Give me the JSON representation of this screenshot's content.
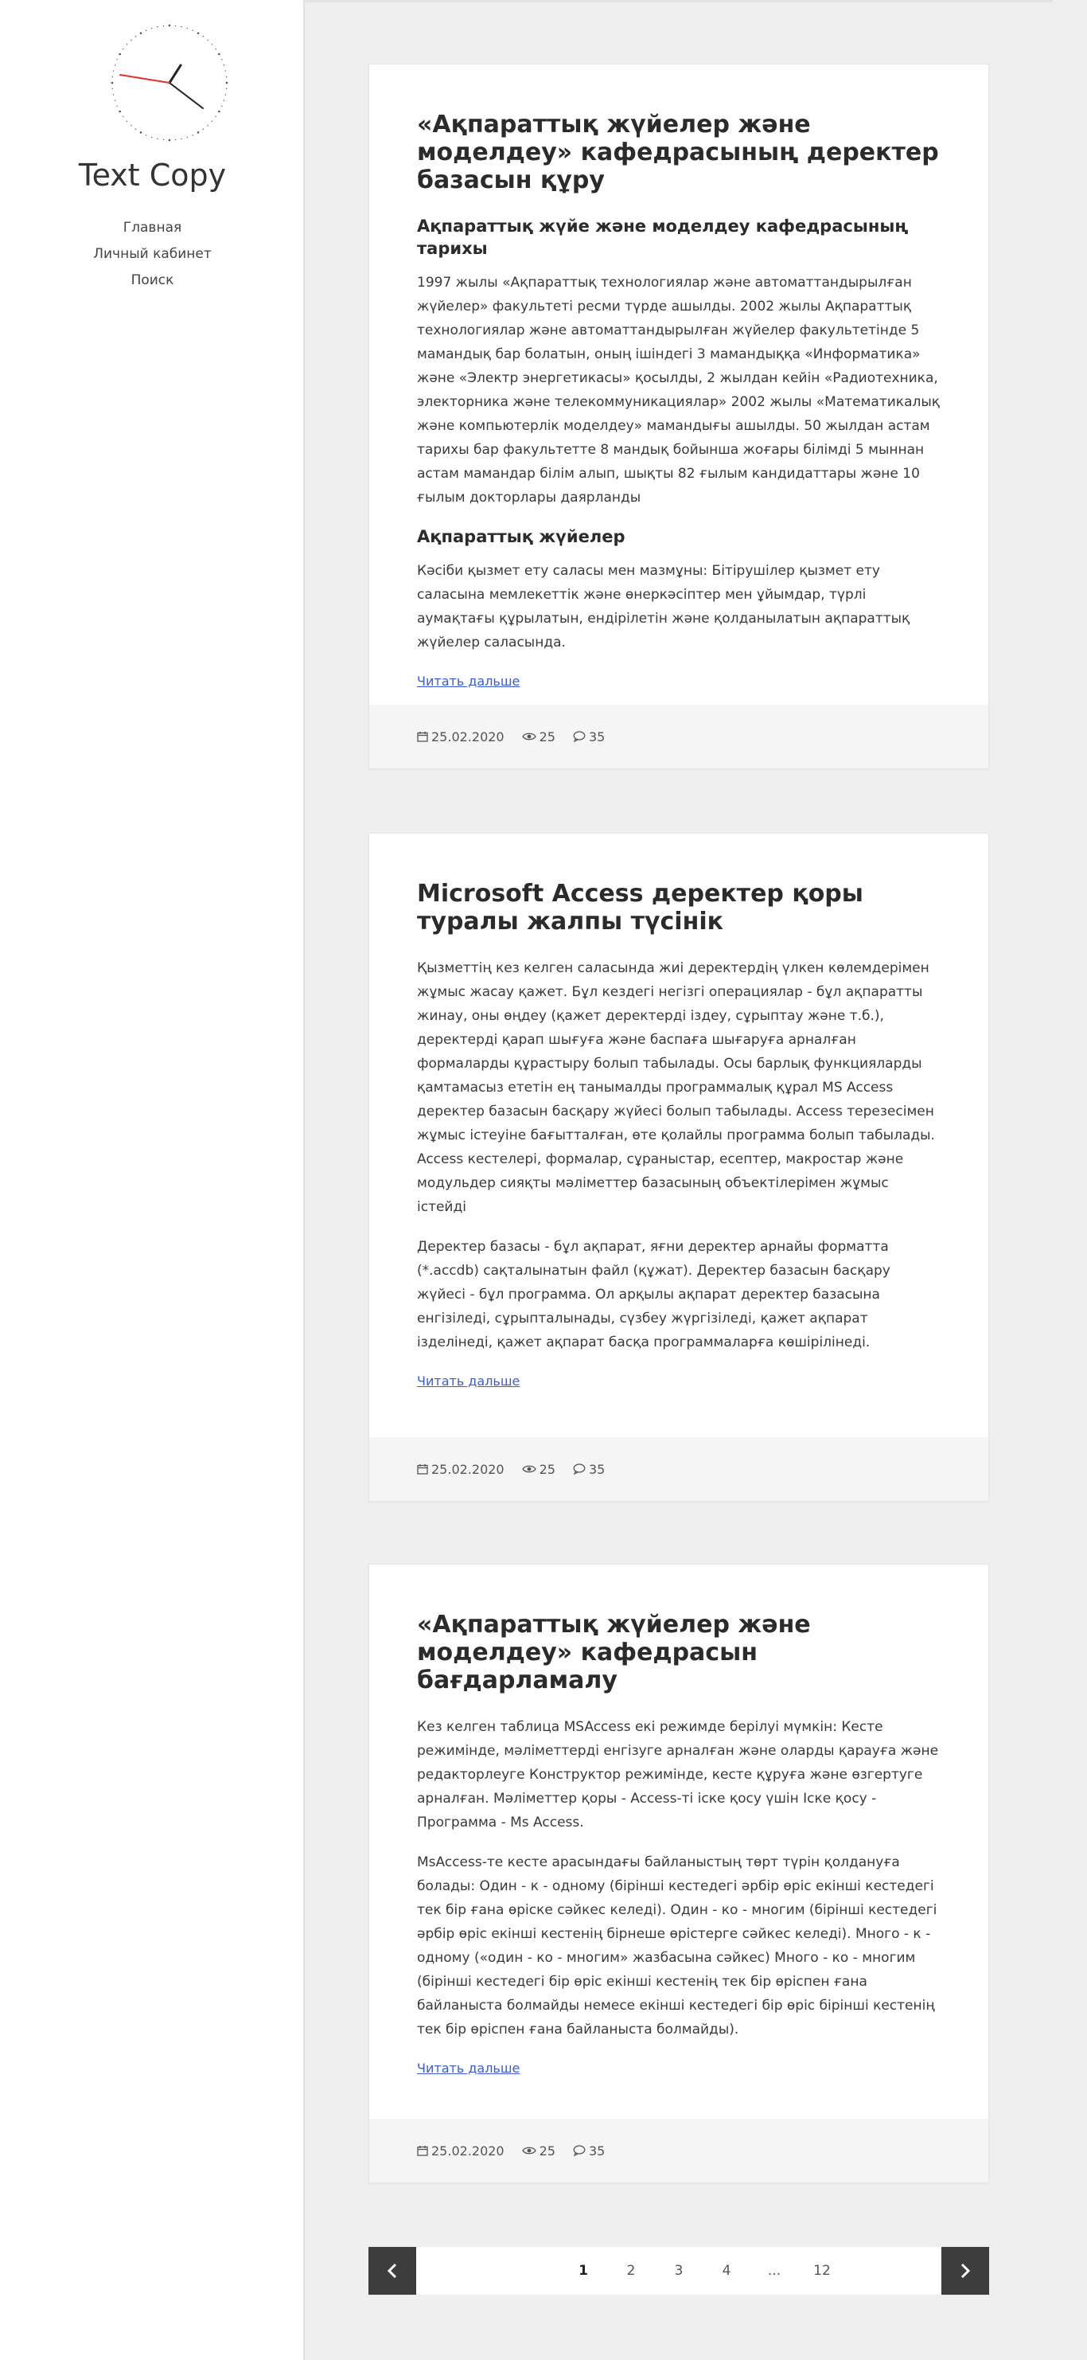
{
  "sidebar": {
    "site_title": "Text Copy",
    "nav": [
      "Главная",
      "Личный кабинет",
      "Поиск"
    ]
  },
  "posts": [
    {
      "title": "«Ақпараттық жүйелер және моделдеу» кафедрасының деректер базасын құру",
      "subtitle": "Ақпараттық жүйе және моделдеу кафедрасының тарихы",
      "paragraph1": "1997 жылы «Ақпараттық технологиялар және автоматтандырылған жүйелер» факультеті ресми түрде ашылды. 2002 жылы Ақпараттық технологиялар және автоматтандырылған жүйелер факультетінде 5 мамандық бар болатын, оның ішіндегі 3 мамандыққа «Информатика» және «Электр энергетикасы» қосылды, 2 жылдан кейін «Радиотехника, электорника және телекоммуникациялар» 2002 жылы «Математикалық және компьютерлік моделдеу» мамандығы ашылды. 50 жылдан астам тарихы бар факультетте 8 мандық бойынша жоғары білімді 5 мыннан астам мамандар білім алып, шықты 82 ғылым кандидаттары және 10 ғылым докторлары даярланды",
      "subtitle2": "Ақпараттық жүйелер",
      "paragraph2": "Кәсіби қызмет ету саласы мен мазмұны: Бітірушілер қызмет ету саласына мемлекеттік және өнеркәсіптер мен ұйымдар, түрлі аумақтағы құрылатын, ендірілетін және қолданылатын ақпараттық жүйелер саласында.",
      "more": "Читать дальше",
      "date": "25.02.2020",
      "views": "25",
      "comments": "35"
    },
    {
      "title": "Microsoft Access деректер қоры туралы жалпы түсінік",
      "paragraph1": "Қызметтің кез келген саласында жиі деректердің үлкен көлемдерімен жұмыс жасау қажет. Бұл кездегі негізгі операциялар - бұл ақпаратты жинау, оны өңдеу (қажет деректерді іздеу, сұрыптау және т.б.), деректерді қарап шығуға және баспаға шығаруға арналған формаларды құрастыру болып табылады. Осы барлық функцияларды қамтамасыз ететін ең танымалды программалық құрал MS Access деректер базасын басқару жүйесі болып табылады. Access терезесімен жұмыс істеуіне бағытталған, өте қолайлы программа болып табылады. Access кестелері, формалар, сұраныстар, есептер, макростар және модульдер сияқты мәліметтер базасының объектілерімен жұмыс істейді",
      "paragraph2": "Деректер базасы - бұл ақпарат, яғни деректер арнайы форматта (*.accdb) сақталынатын файл (құжат). Деректер базасын басқару жүйесі - бұл программа. Ол арқылы ақпарат деректер базасына енгізіледі, сұрыпталынады, сүзбеу жүргізіледі, қажет ақпарат ізделінеді, қажет ақпарат басқа программаларға көшірілінеді.",
      "more": "Читать дальше",
      "date": "25.02.2020",
      "views": "25",
      "comments": "35"
    },
    {
      "title": "«Ақпараттық жүйелер және моделдеу» кафедрасын бағдарламалу",
      "paragraph1": "Кез келген таблица MSAccess екі режимде берілуі мүмкін: Кесте режимінде, мәліметтерді енгізуге арналған және оларды қарауға және редакторлеуге Конструктор режимінде, кесте құруға және өзгертуге арналған. Мәліметтер қоры - Access-ті іске қосу үшін Іске қосу - Программа - Ms Access.",
      "paragraph2": "MsAccess-те кесте арасындағы байланыстың төрт түрін қолдануға болады: Один - к - одному (бірінші кестедегі әрбір өріс екінші кестедегі тек бір ғана өріске сәйкес келеді). Один - ко - многим (бірінші кестедегі әрбір өріс екінші кестенің бірнеше өрістерге сәйкес келеді). Много - к - одному («один - ко - многим» жазбасына сәйкес) Много - ко - многим (бірінші кестедегі бір өріс екінші кестенің тек бір өріспен ғана байланыста болмайды немесе екінші кестедегі бір өріс бірінші кестенің тек бір өріспен ғана байланыста болмайды).",
      "more": "Читать дальше",
      "date": "25.02.2020",
      "views": "25",
      "comments": "35"
    }
  ],
  "pagination": {
    "pages": [
      "1",
      "2",
      "3",
      "4",
      "...",
      "12"
    ],
    "current": "1",
    "prev_icon": "chevron-left-icon",
    "next_icon": "chevron-right-icon"
  },
  "colors": {
    "background": "#efefef",
    "link": "#3b5bdb",
    "pager_button": "#3d3d3d",
    "clock_second_hand": "#e03131"
  }
}
